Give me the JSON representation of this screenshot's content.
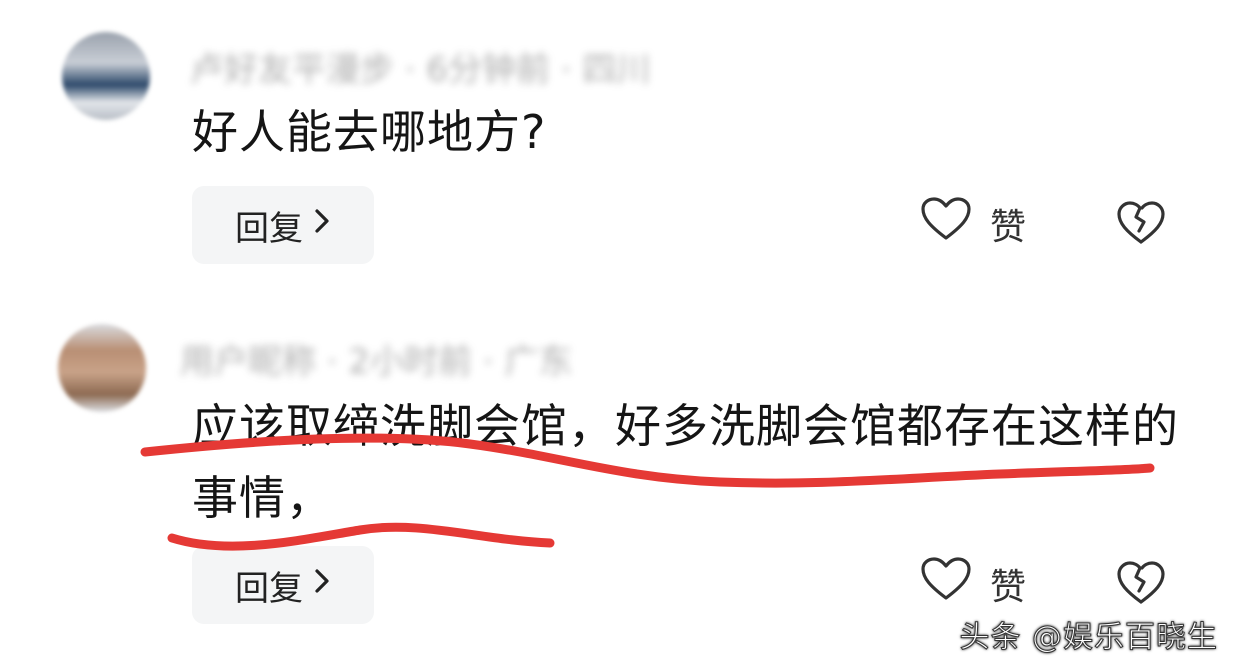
{
  "comments": [
    {
      "meta": "卢好友平漫步 · 6分钟前 · 四川",
      "text": "好人能去哪地方?",
      "reply_label": "回复",
      "like_label": "赞"
    },
    {
      "meta": "用户昵称 · 2小时前 · 广东",
      "text": "应该取缔洗脚会馆，好多洗脚会馆都存在这样的事情，",
      "reply_label": "回复",
      "like_label": "赞"
    }
  ],
  "watermark": "头条 @娱乐百晓生",
  "colors": {
    "annotation_red": "#e53935",
    "reply_bg": "#f4f5f6",
    "text": "#151515"
  },
  "icons": {
    "like": "heart-outline-icon",
    "dislike": "broken-heart-icon",
    "reply": "chevron-right-icon"
  }
}
